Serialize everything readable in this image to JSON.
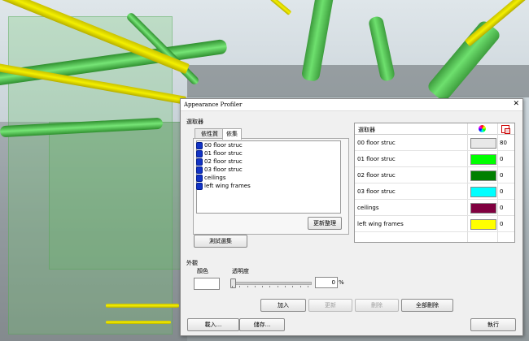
{
  "dialog": {
    "title": "Appearance Profiler",
    "close_glyph": "✕",
    "selector_group_label": "選取器",
    "tabs": [
      "依性質",
      "依集"
    ],
    "tree_items": [
      "00 floor struc",
      "01 floor struc",
      "02 floor struc",
      "03 floor struc",
      "ceilings",
      "left wing frames"
    ],
    "update_button": "更新整理",
    "test_select_button": "測試選集",
    "appearance_label": "外觀",
    "color_label": "顏色",
    "transparency_label": "透明度",
    "transparency_value": "0",
    "percent_sign": "%",
    "transparency_level_percent": 0,
    "add_button": "加入",
    "update_disabled_button": "更新",
    "delete_button": "刪除",
    "delete_all_button": "全部刪除",
    "load_button": "載入...",
    "save_button": "儲存...",
    "run_button": "執行"
  },
  "grid": {
    "header": "選取器",
    "rows": [
      {
        "name": "00 floor struc",
        "color": "#e8e8e8",
        "value": "80"
      },
      {
        "name": "01 floor struc",
        "color": "#00ff00",
        "value": "0"
      },
      {
        "name": "02 floor struc",
        "color": "#008000",
        "value": "0"
      },
      {
        "name": "03 floor struc",
        "color": "#00ffff",
        "value": "0"
      },
      {
        "name": "ceilings",
        "color": "#800040",
        "value": "0"
      },
      {
        "name": "left wing frames",
        "color": "#ffff00",
        "value": "0"
      }
    ]
  },
  "icons": [
    "color-wheel-icon",
    "transparency-icon",
    "close-icon",
    "set-icon"
  ]
}
